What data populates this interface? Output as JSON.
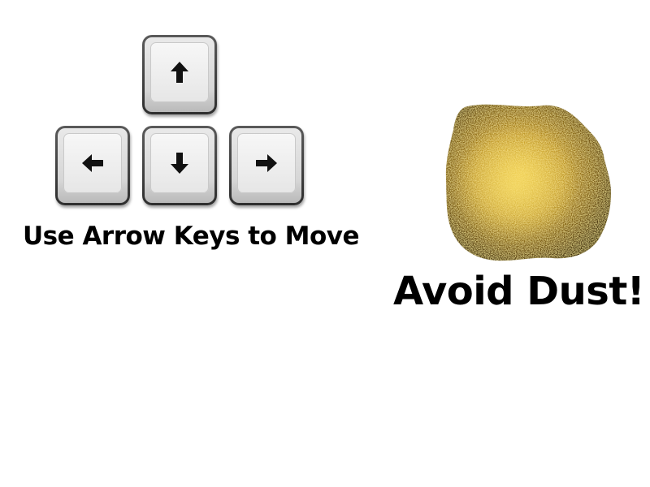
{
  "controls": {
    "keys": [
      {
        "id": "up",
        "icon": "arrow-up-icon",
        "glyph": "↑"
      },
      {
        "id": "left",
        "icon": "arrow-left-icon",
        "glyph": "←"
      },
      {
        "id": "down",
        "icon": "arrow-down-icon",
        "glyph": "↓"
      },
      {
        "id": "right",
        "icon": "arrow-right-icon",
        "glyph": "→"
      }
    ],
    "instruction": "Use Arrow Keys to Move"
  },
  "hazard": {
    "icon": "dust-cloud-icon",
    "warning": "Avoid Dust!",
    "colors": {
      "base": "#7a5a10",
      "glow": "#f3cf45",
      "dark": "#2a1e05"
    }
  }
}
